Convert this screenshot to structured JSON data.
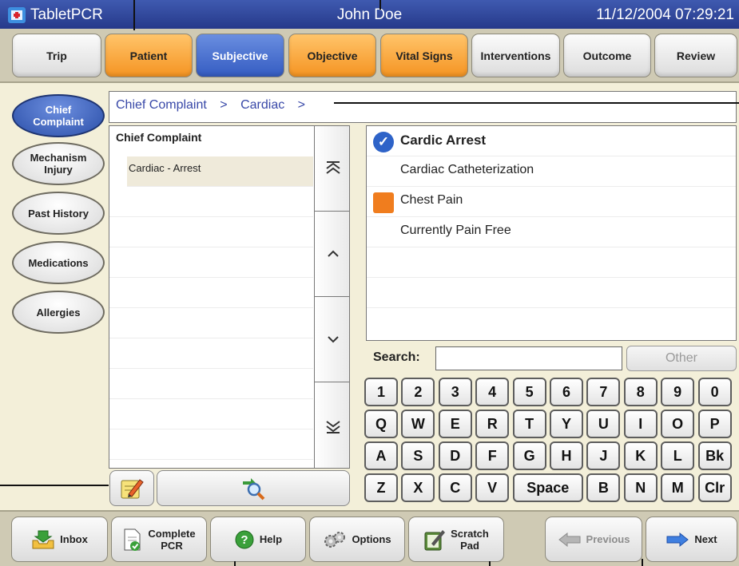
{
  "titlebar": {
    "app_name": "TabletPCR",
    "user": "John Doe",
    "datetime": "11/12/2004 07:29:21"
  },
  "tabs": [
    {
      "label": "Trip",
      "style": "gray"
    },
    {
      "label": "Patient",
      "style": "orange"
    },
    {
      "label": "Subjective",
      "style": "blue"
    },
    {
      "label": "Objective",
      "style": "orange"
    },
    {
      "label": "Vital Signs",
      "style": "orange"
    },
    {
      "label": "Interventions",
      "style": "gray"
    },
    {
      "label": "Outcome",
      "style": "gray"
    },
    {
      "label": "Review",
      "style": "gray"
    }
  ],
  "sidebar": [
    {
      "line1": "Chief",
      "line2": "Complaint",
      "active": true
    },
    {
      "line1": "Mechanism",
      "line2": "Injury",
      "active": false
    },
    {
      "line1": "Past History",
      "line2": "",
      "active": false
    },
    {
      "line1": "Medications",
      "line2": "",
      "active": false
    },
    {
      "line1": "Allergies",
      "line2": "",
      "active": false
    }
  ],
  "breadcrumb": {
    "part1": "Chief Complaint",
    "sep": ">",
    "part2": "Cardiac"
  },
  "left_list": {
    "header": "Chief Complaint",
    "selected_item": "Cardiac - Arrest"
  },
  "scroll_buttons": [
    "page-up-icon",
    "up-icon",
    "down-icon",
    "page-down-icon"
  ],
  "right_list": [
    {
      "label": "Cardic Arrest",
      "marker": "check",
      "bold": true
    },
    {
      "label": "Cardiac Catheterization",
      "marker": "none",
      "bold": false
    },
    {
      "label": "Chest Pain",
      "marker": "orange-square",
      "bold": false
    },
    {
      "label": "Currently Pain Free",
      "marker": "none",
      "bold": false
    }
  ],
  "search": {
    "label": "Search:",
    "value": "",
    "other_label": "Other"
  },
  "keyboard": {
    "row1": [
      "1",
      "2",
      "3",
      "4",
      "5",
      "6",
      "7",
      "8",
      "9",
      "0"
    ],
    "row2": [
      "Q",
      "W",
      "E",
      "R",
      "T",
      "Y",
      "U",
      "I",
      "O",
      "P"
    ],
    "row3": [
      "A",
      "S",
      "D",
      "F",
      "G",
      "H",
      "J",
      "K",
      "L",
      "Bk"
    ],
    "row4": [
      "Z",
      "X",
      "C",
      "V",
      "Space",
      "B",
      "N",
      "M",
      "Clr"
    ]
  },
  "bottom_nav": {
    "inbox": "Inbox",
    "complete_1": "Complete",
    "complete_2": "PCR",
    "help": "Help",
    "options": "Options",
    "scratch_1": "Scratch",
    "scratch_2": "Pad",
    "previous": "Previous",
    "next": "Next"
  },
  "colors": {
    "titlebar": "#26398a",
    "orange_tab": "#f59422",
    "blue_tab": "#355cc2",
    "panel_bg": "#f3efd9",
    "accent_orange": "#f07d1e",
    "check_blue": "#2e63c8"
  }
}
